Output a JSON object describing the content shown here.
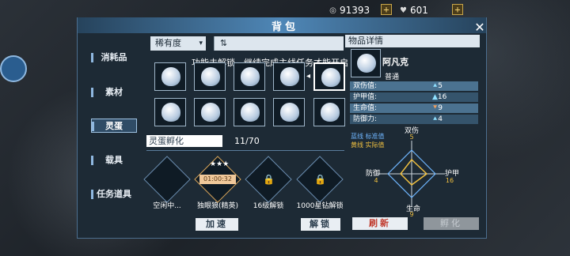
{
  "currency": {
    "coins": {
      "icon": "coin-icon",
      "value": "91393"
    },
    "gems": {
      "icon": "heart-gem-icon",
      "value": "601"
    },
    "plus": "+"
  },
  "panel": {
    "title": "背包",
    "close": "✕"
  },
  "tabs": [
    "消耗品",
    "素材",
    "灵蛋",
    "载具",
    "任务道具"
  ],
  "filter": {
    "sort_label": "稀有度",
    "sort_toggle": "⇅"
  },
  "banner": "功能未解锁，继续完成主线任务才能开启",
  "grid": {
    "arrow": "◂",
    "slot_count": 10,
    "selected_index": 4
  },
  "incubation": {
    "label": "灵蛋孵化",
    "count": "11/70",
    "slots": [
      {
        "label": "空闲中...",
        "state": "idle"
      },
      {
        "label": "独眼狼(精英)",
        "state": "hatching",
        "stars": "★★★",
        "timer": "01:00:32"
      },
      {
        "label": "16级解锁",
        "state": "locked"
      },
      {
        "label": "1000星钻解锁",
        "state": "locked"
      }
    ]
  },
  "buttons": {
    "speedup": "加速",
    "unlock": "解锁",
    "refresh": "刷新",
    "hatch": "孵化"
  },
  "detail": {
    "header": "物品详情",
    "name": "阿凡克",
    "grade": "普通",
    "stats": [
      {
        "label": "双伤值:",
        "arrow": "⯅",
        "value": "5"
      },
      {
        "label": "护甲值:",
        "arrow": "▲",
        "value": "16"
      },
      {
        "label": "生命值:",
        "arrow": "⯆",
        "value": "9"
      },
      {
        "label": "防御力:",
        "arrow": "⯅",
        "value": "4"
      }
    ],
    "legend_blue": "蓝线 标准值",
    "legend_yellow": "黄线 实际值",
    "radar": {
      "top": {
        "label": "双伤",
        "value": "5"
      },
      "right": {
        "label": "护甲",
        "value": "16"
      },
      "bottom": {
        "label": "生命",
        "value": "9"
      },
      "left": {
        "label": "防御",
        "value": "4"
      }
    }
  },
  "colors": {
    "accent": "#4f87b7",
    "highlight": "#f0c040",
    "danger": "#c0392b"
  }
}
